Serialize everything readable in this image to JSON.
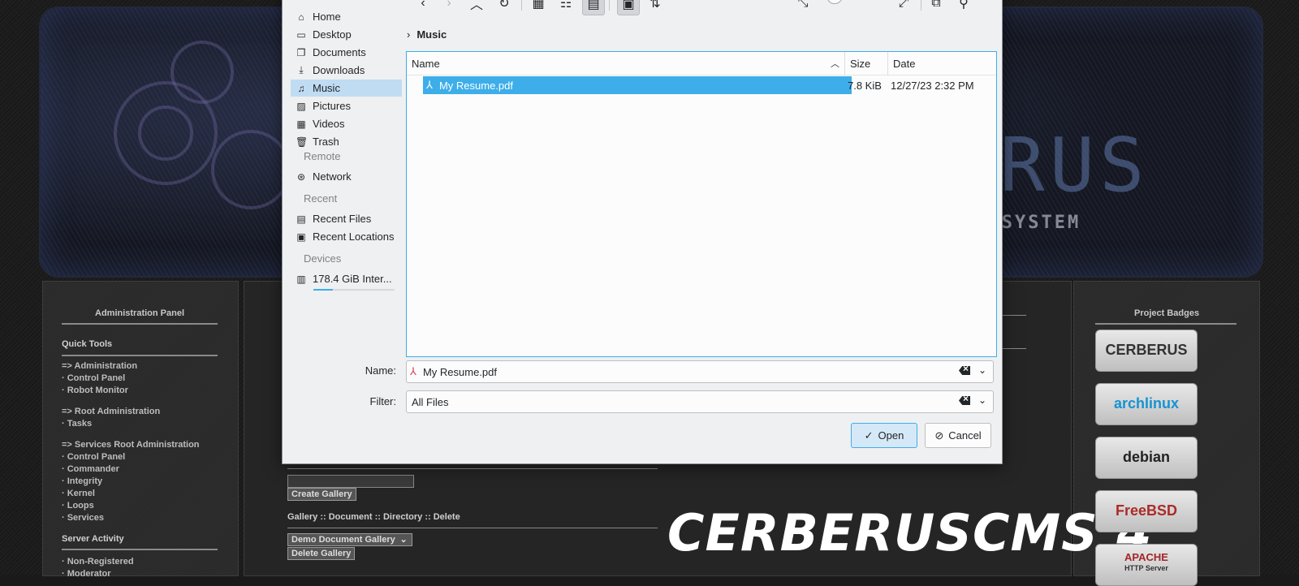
{
  "background_page": {
    "admin_panel": {
      "title": "Administration Panel",
      "quick_tools_heading": "Quick Tools",
      "items": [
        "=> Administration",
        "· Control Panel",
        "· Robot Monitor",
        "=> Root Administration",
        "· Tasks",
        "=> Services Root Administration",
        "· Control Panel",
        "· Commander",
        "· Integrity",
        "· Kernel",
        "· Loops",
        "· Services"
      ],
      "server_activity_heading": "Server Activity",
      "activity_items": [
        "· Non-Registered",
        "· Moderator"
      ]
    },
    "gallery": {
      "create_button": "Create Gallery",
      "links": "Gallery :: Document :: Directory :: Delete",
      "select_value": "Demo Document Gallery",
      "delete_button": "Delete Gallery"
    },
    "badges": {
      "title": "Project Badges",
      "items": [
        "CERBERUS",
        "archlinux",
        "debian",
        "FreeBSD",
        "APACHE"
      ],
      "apache_sub": "HTTP Server"
    },
    "banner": {
      "logo_text": "ERUS",
      "subtitle": "GEMENT SYSTEM"
    },
    "promo_text": "CERBERUSCMS 4"
  },
  "dialog": {
    "places": {
      "items": [
        {
          "label": "Home",
          "icon": "home-icon"
        },
        {
          "label": "Desktop",
          "icon": "desktop-icon"
        },
        {
          "label": "Documents",
          "icon": "documents-icon"
        },
        {
          "label": "Downloads",
          "icon": "downloads-icon"
        },
        {
          "label": "Music",
          "icon": "music-icon",
          "selected": true
        },
        {
          "label": "Pictures",
          "icon": "pictures-icon"
        },
        {
          "label": "Videos",
          "icon": "videos-icon"
        },
        {
          "label": "Trash",
          "icon": "trash-icon"
        }
      ],
      "remote_heading": "Remote",
      "network": "Network",
      "recent_heading": "Recent",
      "recent_files": "Recent Files",
      "recent_locations": "Recent Locations",
      "devices_heading": "Devices",
      "device": "178.4 GiB Inter...",
      "device_usage_fraction": 0.24
    },
    "breadcrumb": "Music",
    "columns": {
      "name": "Name",
      "size": "Size",
      "date": "Date"
    },
    "files": [
      {
        "name": "My Resume.pdf",
        "size": "7.8 KiB",
        "date": "12/27/23 2:32 PM",
        "selected": true
      }
    ],
    "name_label": "Name:",
    "name_value": "My Resume.pdf",
    "filter_label": "Filter:",
    "filter_value": "All Files",
    "open_button": "Open",
    "cancel_button": "Cancel",
    "accent_color": "#3daee9"
  }
}
